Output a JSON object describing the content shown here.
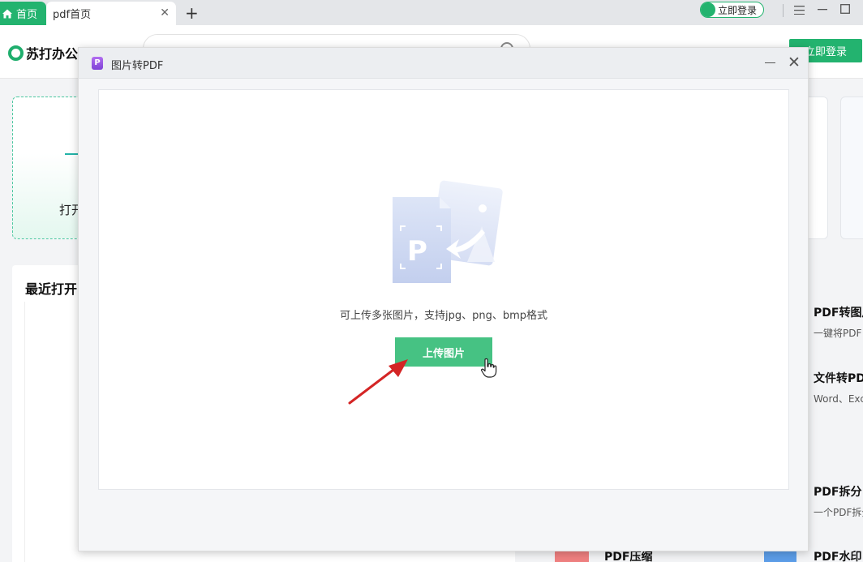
{
  "tabs": {
    "home_label": "首页",
    "active_label": "pdf首页",
    "close_glyph": "✕",
    "add_glyph": "+"
  },
  "titlebar": {
    "login_label": "立即登录"
  },
  "header": {
    "brand": "苏打办公",
    "login_button": "立即登录"
  },
  "workspace": {
    "open_card_label": "打开",
    "recent_title": "最近打开",
    "tools": [
      {
        "title": "PDF转图片",
        "desc": "一键将PDF"
      },
      {
        "title": "文件转PD",
        "desc": "Word、Exc"
      },
      {
        "title": "PDF拆分",
        "desc": "一个PDF拆分"
      },
      {
        "title": "PDF压缩",
        "desc": ""
      },
      {
        "title": "PDF水印",
        "desc": ""
      }
    ]
  },
  "modal": {
    "title": "图片转PDF",
    "hint": "可上传多张图片，支持jpg、png、bmp格式",
    "upload_button": "上传图片",
    "logo_letter": "P",
    "illustration_letter": "P"
  },
  "colors": {
    "brand_green": "#23b36f",
    "button_green": "#46c283",
    "arrow_red": "#d42525"
  },
  "icons": {
    "home": "home-icon",
    "search": "search-icon",
    "close": "close-icon",
    "minimize": "minimize-icon",
    "menu": "menu-icon",
    "maximize": "maximize-icon",
    "pointer": "hand-pointer-icon"
  }
}
